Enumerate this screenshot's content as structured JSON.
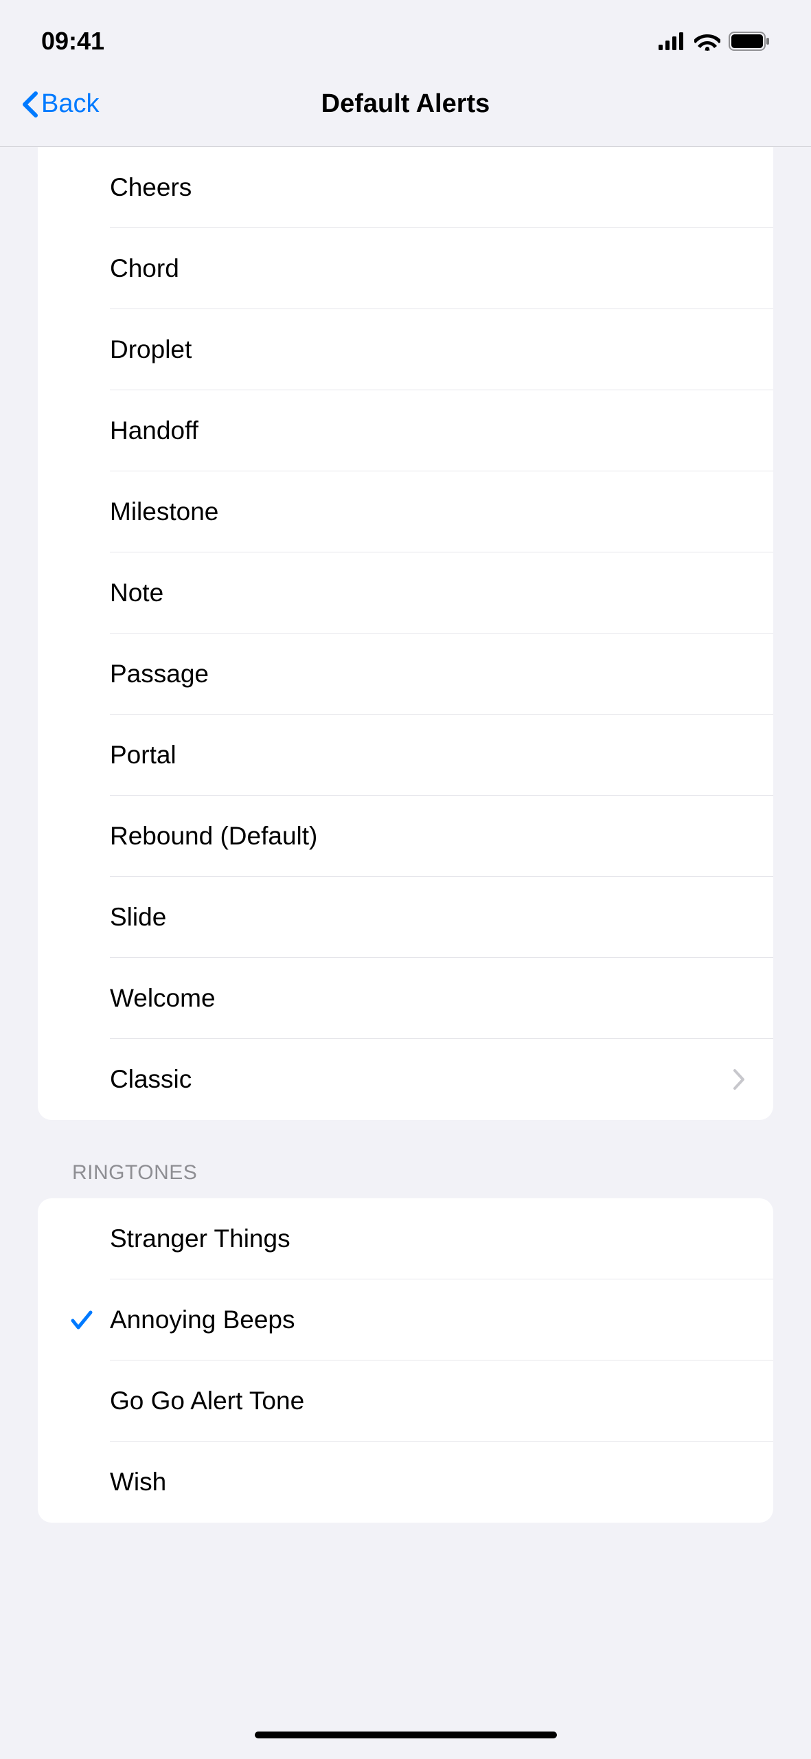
{
  "status": {
    "time": "09:41"
  },
  "nav": {
    "back_label": "Back",
    "title": "Default Alerts"
  },
  "alert_tones": [
    {
      "label": "Cheers",
      "selected": false
    },
    {
      "label": "Chord",
      "selected": false
    },
    {
      "label": "Droplet",
      "selected": false
    },
    {
      "label": "Handoff",
      "selected": false
    },
    {
      "label": "Milestone",
      "selected": false
    },
    {
      "label": "Note",
      "selected": false
    },
    {
      "label": "Passage",
      "selected": false
    },
    {
      "label": "Portal",
      "selected": false
    },
    {
      "label": "Rebound (Default)",
      "selected": false
    },
    {
      "label": "Slide",
      "selected": false
    },
    {
      "label": "Welcome",
      "selected": false
    },
    {
      "label": "Classic",
      "selected": false,
      "has_chevron": true
    }
  ],
  "ringtones_header": "RINGTONES",
  "ringtones": [
    {
      "label": "Stranger Things",
      "selected": false
    },
    {
      "label": "Annoying Beeps",
      "selected": true
    },
    {
      "label": "Go Go Alert Tone",
      "selected": false
    },
    {
      "label": "Wish",
      "selected": false
    }
  ]
}
